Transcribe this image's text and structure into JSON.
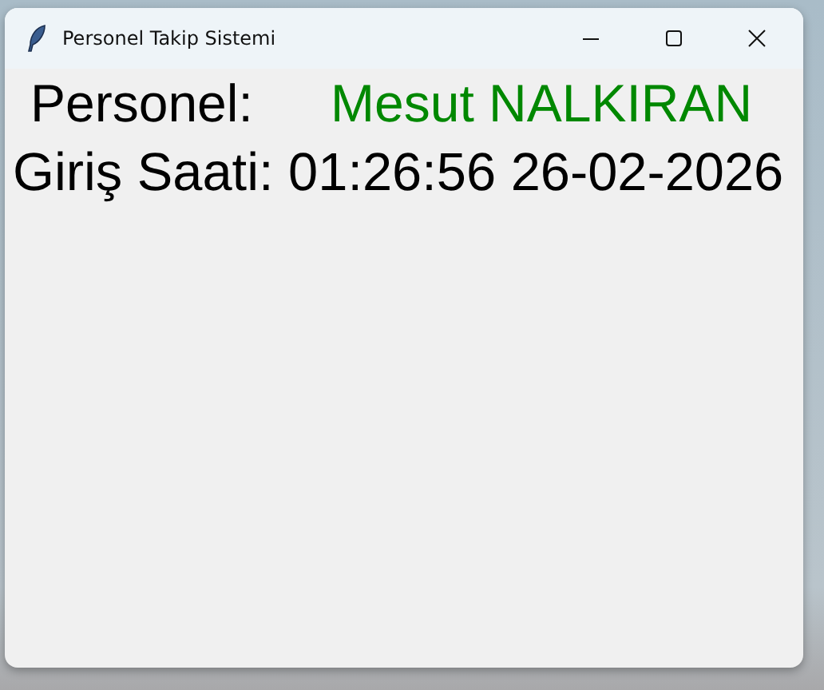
{
  "window": {
    "title": "Personel Takip Sistemi"
  },
  "personnel": {
    "label": "Personel:",
    "name": "Mesut NALKIRAN"
  },
  "login_time": "Giriş Saati: 01:26:56 26-02-2026"
}
